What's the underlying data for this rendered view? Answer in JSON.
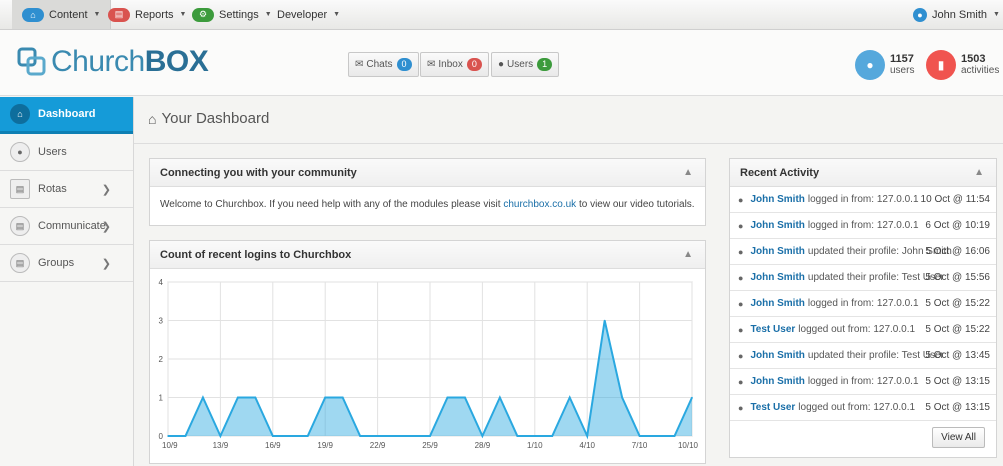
{
  "topnav": {
    "items": [
      {
        "label": "Content",
        "icon": "home-icon",
        "color": "#2f8fd0"
      },
      {
        "label": "Reports",
        "icon": "reports-icon",
        "color": "#d9534f"
      },
      {
        "label": "Settings",
        "icon": "gear-icon",
        "color": "#3c9b3c"
      },
      {
        "label": "Developer"
      }
    ],
    "user": "John Smith"
  },
  "logo": {
    "part1": "Church",
    "part2": "BOX"
  },
  "header": {
    "chats": {
      "label": "Chats",
      "count": "0"
    },
    "inbox": {
      "label": "Inbox",
      "count": "0"
    },
    "users": {
      "label": "Users",
      "count": "1"
    },
    "stat_users": {
      "num": "1157",
      "label": "users"
    },
    "stat_activities": {
      "num": "1503",
      "label": "activities"
    }
  },
  "sidebar": {
    "items": [
      {
        "label": "Dashboard"
      },
      {
        "label": "Users"
      },
      {
        "label": "Rotas"
      },
      {
        "label": "Communicate"
      },
      {
        "label": "Groups"
      }
    ]
  },
  "page": {
    "title": "Your Dashboard"
  },
  "welcome": {
    "title": "Connecting you with your community",
    "text_before": "Welcome to Churchbox. If you need help with any of the modules please visit",
    "link": "churchbox.co.uk",
    "text_after": "to view our video tutorials."
  },
  "logins": {
    "title": "Count of recent logins to Churchbox"
  },
  "chart_data": {
    "type": "area",
    "title": "Count of recent logins to Churchbox",
    "xlabel": "",
    "ylabel": "",
    "ylim": [
      0,
      4
    ],
    "yticks": [
      "0",
      "1",
      "2",
      "3",
      "4"
    ],
    "xticks": [
      "10/9",
      "13/9",
      "16/9",
      "19/9",
      "22/9",
      "25/9",
      "28/9",
      "1/10",
      "4/10",
      "7/10",
      "10/10"
    ],
    "values": [
      0,
      0,
      1,
      0,
      1,
      1,
      0,
      0,
      0,
      1,
      1,
      0,
      0,
      0,
      0,
      0,
      1,
      1,
      0,
      1,
      0,
      0,
      0,
      1,
      0,
      3,
      1,
      0,
      0,
      0,
      1
    ],
    "color": "#2aa8e0"
  },
  "activity": {
    "title": "Recent Activity",
    "view_all": "View All",
    "rows": [
      {
        "user": "John Smith",
        "text": "logged in from: 127.0.0.1",
        "time": "10 Oct @ 11:54"
      },
      {
        "user": "John Smith",
        "text": "logged in from: 127.0.0.1",
        "time": "6 Oct @ 10:19"
      },
      {
        "user": "John Smith",
        "text": "updated their profile: John Smith",
        "time": "5 Oct @ 16:06"
      },
      {
        "user": "John Smith",
        "text": "updated their profile: Test User",
        "time": "5 Oct @ 15:56"
      },
      {
        "user": "John Smith",
        "text": "logged in from: 127.0.0.1",
        "time": "5 Oct @ 15:22"
      },
      {
        "user": "Test User",
        "text": "logged out from: 127.0.0.1",
        "time": "5 Oct @ 15:22"
      },
      {
        "user": "John Smith",
        "text": "updated their profile: Test User",
        "time": "5 Oct @ 13:45"
      },
      {
        "user": "John Smith",
        "text": "logged in from: 127.0.0.1",
        "time": "5 Oct @ 13:15"
      },
      {
        "user": "Test User",
        "text": "logged out from: 127.0.0.1",
        "time": "5 Oct @ 13:15"
      }
    ]
  }
}
